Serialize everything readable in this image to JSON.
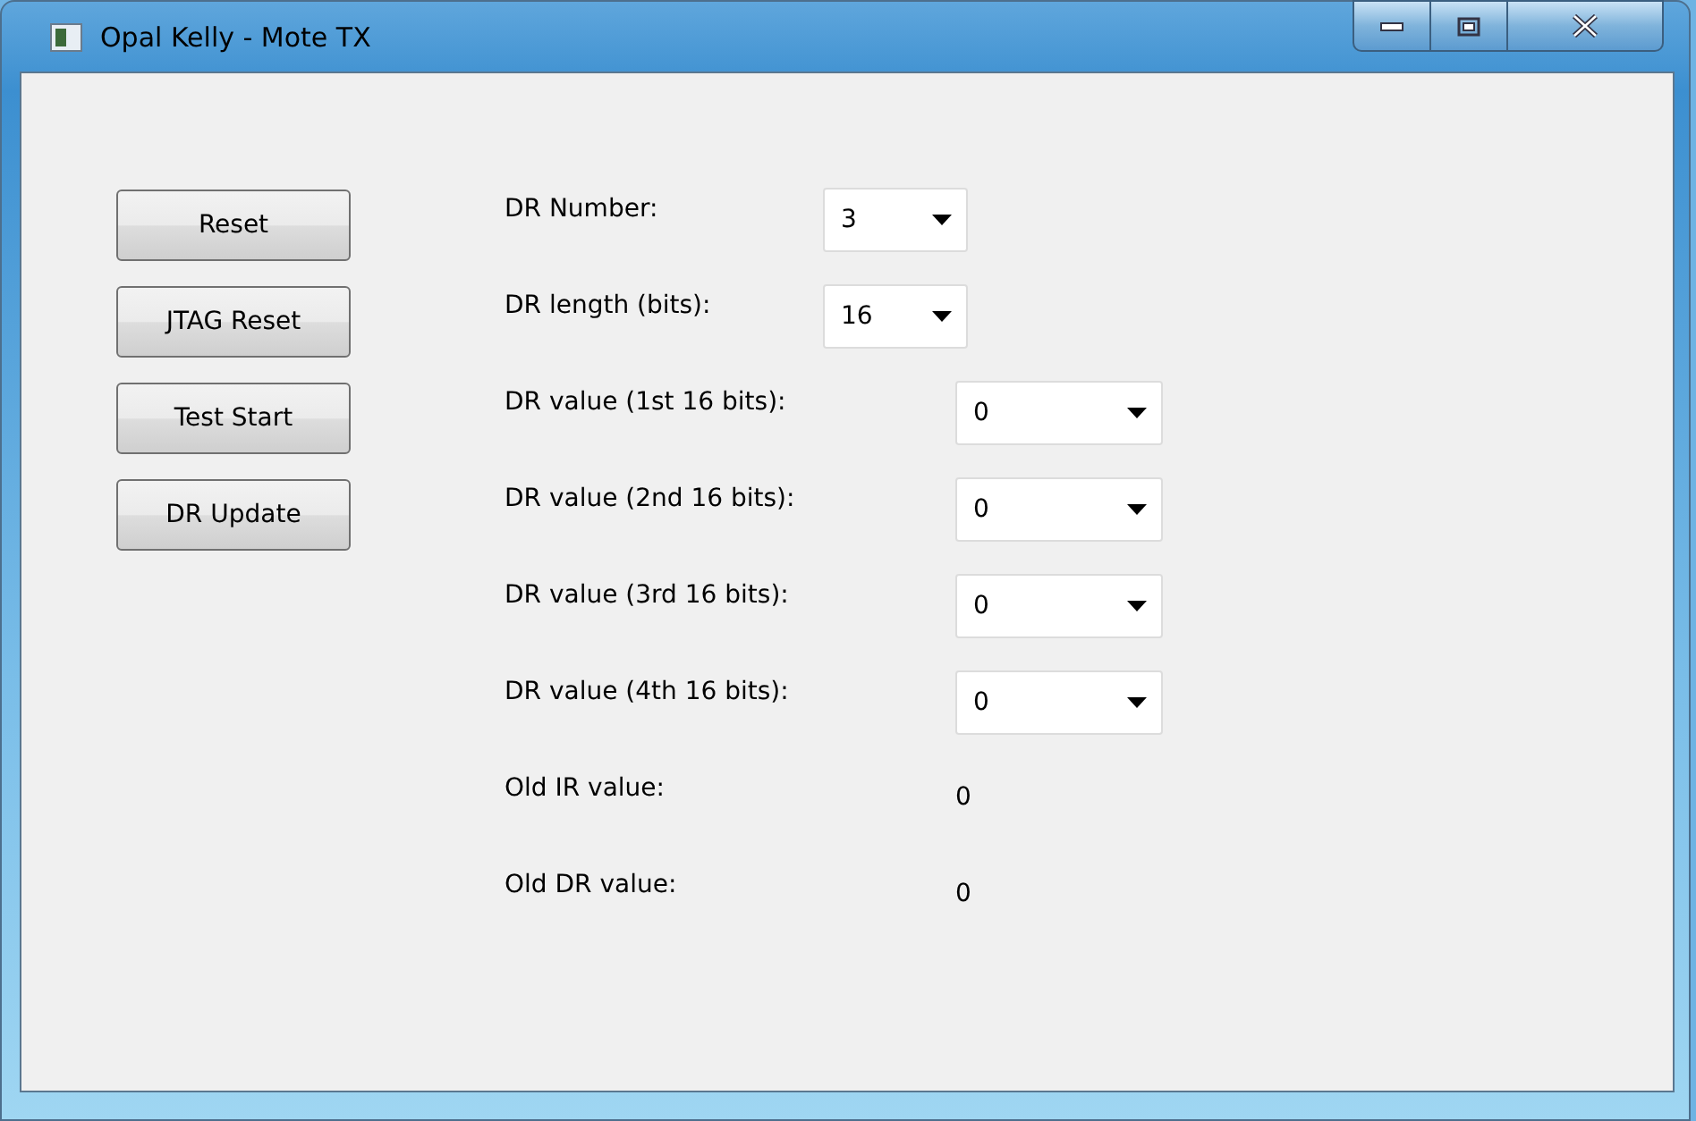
{
  "window": {
    "title": "Opal Kelly - Mote TX"
  },
  "buttons": [
    "Reset",
    "JTAG Reset",
    "Test Start",
    "DR Update"
  ],
  "fields": [
    {
      "kind": "short-combo",
      "label": "DR Number:",
      "value": "3"
    },
    {
      "kind": "short-combo",
      "label": "DR length (bits):",
      "value": "16"
    },
    {
      "kind": "combo",
      "label": "DR value (1st 16 bits):",
      "value": "0"
    },
    {
      "kind": "combo",
      "label": "DR value (2nd 16 bits):",
      "value": "0"
    },
    {
      "kind": "combo",
      "label": "DR value (3rd 16 bits):",
      "value": "0"
    },
    {
      "kind": "combo",
      "label": "DR value (4th 16 bits):",
      "value": "0"
    },
    {
      "kind": "value",
      "label": "Old IR value:",
      "value": "0"
    },
    {
      "kind": "value",
      "label": "Old DR value:",
      "value": "0"
    }
  ]
}
